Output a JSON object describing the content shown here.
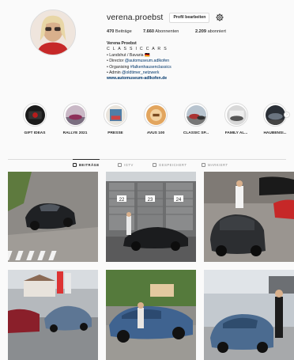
{
  "profile": {
    "username": "verena.proebst",
    "edit_button": "Profil bearbeiten",
    "stats": [
      {
        "value": "470",
        "label": "Beiträge"
      },
      {
        "value": "7.660",
        "label": "Abonnenten"
      },
      {
        "value": "2.209",
        "label": "abonniert"
      }
    ],
    "bio": {
      "name": "Verena Proebst",
      "line1": "C L A S S I C C A R S",
      "line2": "• Landshut / Bavaria 🇩🇪",
      "line3_prefix": "• Director ",
      "line3_tag": "@automuseum.adlkofen",
      "line4_prefix": "• Organising ",
      "line4_tag": "#falkenhausenclassics",
      "line5_prefix": "• Admin ",
      "line5_tag": "@oldtimer_netzwerk",
      "link": "www.automuseum-adlkofen.de"
    }
  },
  "highlights": [
    {
      "label": "GIFT IDEAS"
    },
    {
      "label": "RALLYE 2021"
    },
    {
      "label": "PRESSE"
    },
    {
      "label": "AVUS 100"
    },
    {
      "label": "CLASSIC SP..."
    },
    {
      "label": "FAMILY AL..."
    },
    {
      "label": "HAUBENSI..."
    }
  ],
  "tabs": [
    {
      "label": "BEITRÄGE"
    },
    {
      "label": "IGTV"
    },
    {
      "label": "GESPEICHERT"
    },
    {
      "label": "MARKIERT"
    }
  ],
  "grid": {
    "garage_numbers": [
      "22",
      "23",
      "24"
    ]
  },
  "colors": {
    "link": "#00376b",
    "border": "#dbdbdb",
    "text": "#262626",
    "muted": "#8e8e8e"
  }
}
